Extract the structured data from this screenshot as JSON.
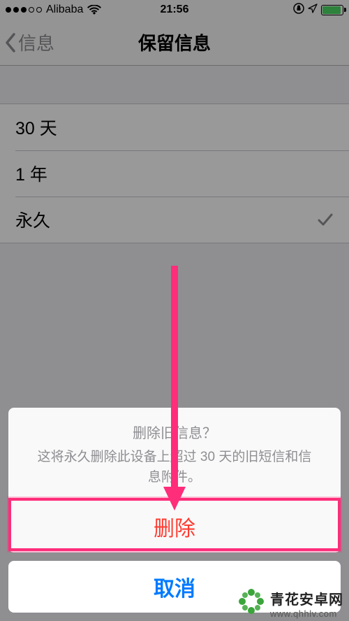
{
  "status": {
    "carrier": "Alibaba",
    "time": "21:56"
  },
  "nav": {
    "back_label": "信息",
    "title": "保留信息"
  },
  "options": {
    "opt_30d": "30 天",
    "opt_1y": "1 年",
    "opt_forever": "永久"
  },
  "sheet": {
    "title": "删除旧信息？",
    "desc_line1": "这将永久删除此设备上超过 30 天的旧短信和信",
    "desc_line2": "息附件。",
    "delete": "删除",
    "cancel": "取消"
  },
  "watermark": {
    "cn": "青花安卓网",
    "url": "www.qhhlv.com"
  }
}
